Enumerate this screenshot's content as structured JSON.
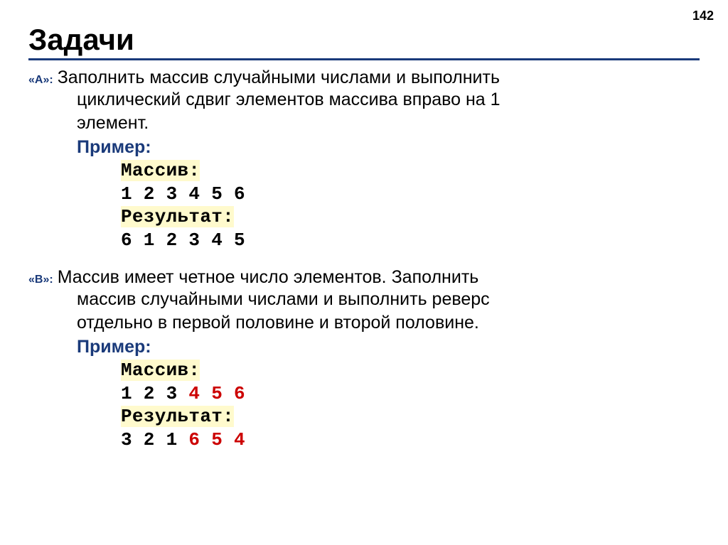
{
  "pageNumber": "142",
  "title": "Задачи",
  "taskA": {
    "label": "«A»:",
    "text1": "Заполнить массив случайными числами и выполнить",
    "text2": "циклический сдвиг элементов массива вправо на 1",
    "text3": "элемент.",
    "exampleLabel": "Пример:",
    "code": {
      "arrayLabel": "Массив:",
      "arrayValues": "1 2 3 4 5 6",
      "resultLabel": "Результат:",
      "resultValues": "6 1 2 3 4 5"
    }
  },
  "taskB": {
    "label": "«B»:",
    "text1": "Массив имеет четное число элементов. Заполнить",
    "text2": "массив случайными числами и выполнить реверс",
    "text3": "отдельно в первой половине и второй половине.",
    "exampleLabel": "Пример:",
    "code": {
      "arrayLabel": "Массив:",
      "arrayValuesBlack": "1 2 3",
      "arrayValuesRed": "4 5 6",
      "resultLabel": "Результат:",
      "resultValuesBlack": "3 2 1",
      "resultValuesRed": "6 5 4"
    }
  }
}
